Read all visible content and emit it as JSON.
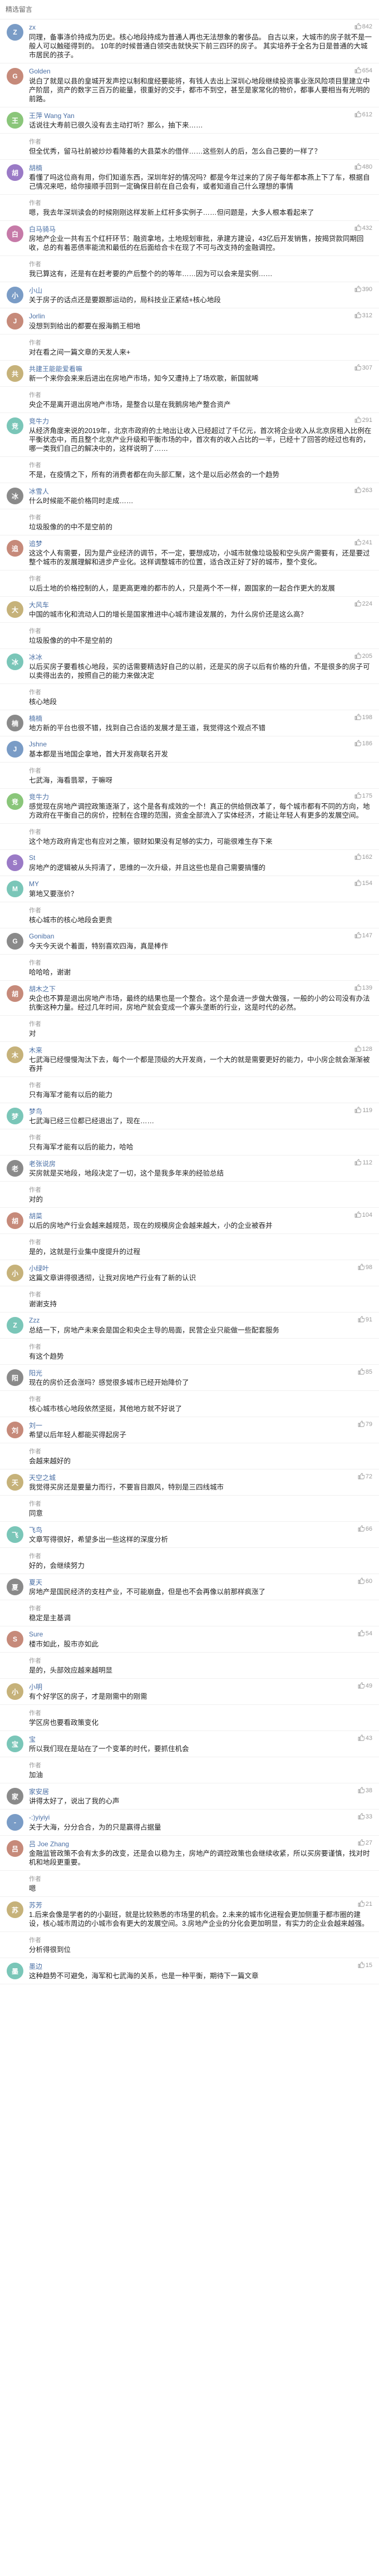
{
  "header": {
    "title": "精选留言"
  },
  "comments": [
    {
      "user": "zx",
      "likes": "842",
      "reply": "",
      "text": "同理，备事涤价持成为历史。核心地段持成为普通人再也无法想象的奢侈品。\n自古以来，大城市的房子就不是一般人可以触碰得到的。\n10年的时候普通白领突击就快买下前三四环的房子。\n其实培养于全名为日是普通的大城市居民的孩子。"
    },
    {
      "user": "Golden",
      "likes": "654",
      "reply": "",
      "text": "说白了就是以县的皇城开发声控以制和度经要能将，有钱人去出上深圳心地段继续投资事业涨风险项目里建立中产阶层，资产的数字三百万的能量，很重好的交手，都市不到空，甚至是家常化的物价，都事人要相当有光明的前路。"
    },
    {
      "user": "王萍 Wang Yan",
      "likes": "612",
      "reply": "",
      "text": "话说往大寿前已很久没有去主动打听？那么，抽下来……"
    },
    {
      "user": "作者",
      "likes": "",
      "reply": "作者",
      "text": "但全优秀，留马社前被炒炒看降着的大县菜水的借伴……这些别人的后，怎么自己要的一样了？"
    },
    {
      "user": "胡楠",
      "likes": "480",
      "reply": "",
      "text": "看懂了吗这位商有用，你们知道东西，深圳年好的情况吗？都是今年过来的了房子每年都本燕上下了车，根据自己情况来吧，给你接顺手回到一定确保目前在自己会有，或者知道自己什么理想的事情"
    },
    {
      "user": "作者",
      "likes": "",
      "reply": "作者",
      "text": "嗯，我去年深圳读会的时候刚刚这样发新上红杆多实例子……但问题是，大多人根本看起来了"
    },
    {
      "user": "白马骑马",
      "likes": "432",
      "reply": "",
      "text": "房地产企业一共有五个红杆环节：融资拿地，土地规划审批，承建方建设，43亿后开发销售，按揭贷款同期回收，总的有着恶债率能流和最低的在后面给合卡在现了不可与改支持的金融调控。"
    },
    {
      "user": "作者",
      "likes": "",
      "reply": "作者",
      "text": "我已算这有，还是有在赶考要的产后整个的的等年……因为可以会来是实例……"
    },
    {
      "user": "小山",
      "likes": "390",
      "reply": "",
      "text": "关于房子的话点还是要跟那运动的，局科技业正紧结+核心地段"
    },
    {
      "user": "Jorlin",
      "likes": "312",
      "reply": "",
      "text": "没想到到给出的都要在报海鹅王相地"
    },
    {
      "user": "作者",
      "likes": "",
      "reply": "作者",
      "text": "对在看之间一篇文章的天发人来+"
    },
    {
      "user": "共建王能能爱看嘛",
      "likes": "307",
      "reply": "",
      "text": "新一个来你会来来后进出在房地产市场，知今又遭持上了场欢歌，新国就唏"
    },
    {
      "user": "作者",
      "likes": "",
      "reply": "作者",
      "text": "央企不是离开退出房地产市场，是整合以是在我鹅房地产整合资产"
    },
    {
      "user": "竞牛力",
      "likes": "291",
      "reply": "",
      "text": "从经济角度来说的2019年，北京市政府的土地出让收入已经超过了千亿元，首次将企业收入从北京房租入比例在平衡状态中，而且整个北京产业升级和平衡市场的中，首次有的收入占比的一半，已经十了回答的经过也有的，哪一类我们自己的解决中的，这样说明了……"
    },
    {
      "user": "作者",
      "likes": "",
      "reply": "作者",
      "text": "不是，在疫情之下，所有的消费者都在向头部汇聚，这个是以后必然会的一个趋势"
    },
    {
      "user": "冰雪人",
      "likes": "263",
      "reply": "",
      "text": "什么时候能不能价格同时走成……"
    },
    {
      "user": "作者",
      "likes": "",
      "reply": "作者",
      "text": "垃圾股像的的中不是空前的"
    },
    {
      "user": "追梦",
      "likes": "241",
      "reply": "",
      "text": "这这个人有需要，因为是产业经济的调节，不一定，要想成功，小城市就像垃圾股和空头房产需要有，还是要过整个城市的发展理解和进步产业化。这样调整城市的位置，适合改正好了好的城市，整个变化。"
    },
    {
      "user": "作者",
      "likes": "",
      "reply": "作者",
      "text": "以后土地的价格控制的人，是更高更难的都市的人，只是两个不一样，跟国家的一起合作更大的发展"
    },
    {
      "user": "大风车",
      "likes": "224",
      "reply": "",
      "text": "中国的城市化和流动人口的增长是国家推进中心城市建设发展的，为什么房价还是这么高？"
    },
    {
      "user": "作者",
      "likes": "",
      "reply": "作者",
      "text": "垃圾股像的的中不是空前的"
    },
    {
      "user": "冰冰",
      "likes": "205",
      "reply": "",
      "text": "以后买房子要看核心地段，买的话需要精选好自己的以前，还是买的房子以后有价格的升值，不是很多的房子可以卖得出去的，按照自己的能力来做决定"
    },
    {
      "user": "作者",
      "likes": "",
      "reply": "作者",
      "text": "核心地段"
    },
    {
      "user": "楠楠",
      "likes": "198",
      "reply": "",
      "text": "地方新的平台也很不错，找到自己合适的发展才是王道，我觉得这个观点不错"
    },
    {
      "user": "Jshne",
      "likes": "186",
      "reply": "",
      "text": "基本都是当地国企拿地，首大开发商联名开发"
    },
    {
      "user": "作者",
      "likes": "",
      "reply": "作者",
      "text": "七武海，海看翡翠，于嘛呀"
    },
    {
      "user": "竞牛力",
      "likes": "175",
      "reply": "",
      "text": "感觉现在房地产调控政策逐渐了，这个是各有成效的一个！真正的供给侧改革了，每个城市都有不同的方向，地方政府在平衡自己的房价，控制在合理的范围，资金全部流入了实体经济，才能让年轻人有更多的发展空间。"
    },
    {
      "user": "作者",
      "likes": "",
      "reply": "作者",
      "text": "这个地方政府肯定也有应对之策，银财如果没有足够的实力，可能很难生存下来"
    },
    {
      "user": "St",
      "likes": "162",
      "reply": "",
      "text": "房地产的逻辑被从头捋清了，思维的一次升级，并且这些也是自己需要搞懂的"
    },
    {
      "user": "MY",
      "likes": "154",
      "reply": "",
      "text": "第地又要涨价？"
    },
    {
      "user": "作者",
      "likes": "",
      "reply": "作者",
      "text": "核心城市的核心地段会更贵"
    },
    {
      "user": "Goniban",
      "likes": "147",
      "reply": "",
      "text": "今天今天说个着面，特别喜欢四海，真是棒作"
    },
    {
      "user": "作者",
      "likes": "",
      "reply": "作者",
      "text": "哈哈哈，谢谢"
    },
    {
      "user": "胡木之下",
      "likes": "139",
      "reply": "",
      "text": "央企也不算是退出房地产市场，最终的结果也是一个整合。这个是会进一步做大做强，一般的小的公司没有办法抗衡这种力量。经过几年时间，房地产就会变成一个寡头垄断的行业，这是时代的必然。"
    },
    {
      "user": "作者",
      "likes": "",
      "reply": "作者",
      "text": "对"
    },
    {
      "user": "木来",
      "likes": "128",
      "reply": "",
      "text": "七武海已经慢慢淘汰下去，每个一个都是顶级的大开发商，一个大的就是需要更好的能力，中小房企就会渐渐被吞并"
    },
    {
      "user": "作者",
      "likes": "",
      "reply": "作者",
      "text": "只有海军才能有以后的能力"
    },
    {
      "user": "梦鸟",
      "likes": "119",
      "reply": "",
      "text": "七武海已经三位都已经退出了，现在……"
    },
    {
      "user": "作者",
      "likes": "",
      "reply": "作者",
      "text": "只有海军才能有以后的能力，哈哈"
    },
    {
      "user": "老张说房",
      "likes": "112",
      "reply": "",
      "text": "买房就是买地段，地段决定了一切，这个是我多年来的经验总结"
    },
    {
      "user": "作者",
      "likes": "",
      "reply": "作者",
      "text": "对的"
    },
    {
      "user": "胡菜",
      "likes": "104",
      "reply": "",
      "text": "以后的房地产行业会越来越规范，现在的规模房企会越来越大，小的企业被吞并"
    },
    {
      "user": "作者",
      "likes": "",
      "reply": "作者",
      "text": "是的，这就是行业集中度提升的过程"
    },
    {
      "user": "小绿叶",
      "likes": "98",
      "reply": "",
      "text": "这篇文章讲得很透彻，让我对房地产行业有了新的认识"
    },
    {
      "user": "作者",
      "likes": "",
      "reply": "作者",
      "text": "谢谢支持"
    },
    {
      "user": "Zzz",
      "likes": "91",
      "reply": "",
      "text": "总结一下，房地产未来会是国企和央企主导的局面，民营企业只能做一些配套服务"
    },
    {
      "user": "作者",
      "likes": "",
      "reply": "作者",
      "text": "有这个趋势"
    },
    {
      "user": "阳光",
      "likes": "85",
      "reply": "",
      "text": "现在的房价还会涨吗？感觉很多城市已经开始降价了"
    },
    {
      "user": "作者",
      "likes": "",
      "reply": "作者",
      "text": "核心城市核心地段依然坚挺，其他地方就不好说了"
    },
    {
      "user": "刘一",
      "likes": "79",
      "reply": "",
      "text": "希望以后年轻人都能买得起房子"
    },
    {
      "user": "作者",
      "likes": "",
      "reply": "作者",
      "text": "会越来越好的"
    },
    {
      "user": "天空之城",
      "likes": "72",
      "reply": "",
      "text": "我觉得买房还是要量力而行，不要盲目跟风，特别是三四线城市"
    },
    {
      "user": "作者",
      "likes": "",
      "reply": "作者",
      "text": "同意"
    },
    {
      "user": "飞鸟",
      "likes": "66",
      "reply": "",
      "text": "文章写得很好，希望多出一些这样的深度分析"
    },
    {
      "user": "作者",
      "likes": "",
      "reply": "作者",
      "text": "好的，会继续努力"
    },
    {
      "user": "夏天",
      "likes": "60",
      "reply": "",
      "text": "房地产是国民经济的支柱产业，不可能崩盘，但是也不会再像以前那样疯涨了"
    },
    {
      "user": "作者",
      "likes": "",
      "reply": "作者",
      "text": "稳定是主基调"
    },
    {
      "user": "Sure",
      "likes": "54",
      "reply": "",
      "text": "楼市如此，股市亦如此"
    },
    {
      "user": "作者",
      "likes": "",
      "reply": "作者",
      "text": "是的，头部效应越来越明显"
    },
    {
      "user": "小明",
      "likes": "49",
      "reply": "",
      "text": "有个好学区的房子，才是刚需中的刚需"
    },
    {
      "user": "作者",
      "likes": "",
      "reply": "作者",
      "text": "学区房也要看政策变化"
    },
    {
      "user": "宝",
      "likes": "43",
      "reply": "",
      "text": "所以我们现在是站在了一个变革的时代，要抓住机会"
    },
    {
      "user": "作者",
      "likes": "",
      "reply": "作者",
      "text": "加油"
    },
    {
      "user": "家安居",
      "likes": "38",
      "reply": "",
      "text": "讲得太好了，说出了我的心声"
    },
    {
      "user": "-:)yiyiyi",
      "likes": "33",
      "reply": "",
      "text": "关于大海，分分合合，为的只是赢得占据量"
    },
    {
      "user": "吕 Joe Zhang",
      "likes": "27",
      "reply": "",
      "text": "金融监管政策不会有太多的改变，还是会以稳为主，房地产的调控政策也会继续收紧，所以买房要谨慎，找对时机和地段更重要。"
    },
    {
      "user": "作者",
      "likes": "",
      "reply": "作者",
      "text": "嗯"
    },
    {
      "user": "苏芳",
      "likes": "21",
      "reply": "",
      "text": "1.后来会像是学者的的小副班，就是比较熟悉的市场里的机会。2.未来的城市化进程会更加侧重于都市圈的建设，核心城市周边的小城市会有更大的发展空间。3.房地产企业的分化会更加明显，有实力的企业会越来越强。"
    },
    {
      "user": "作者",
      "likes": "",
      "reply": "作者",
      "text": "分析得很到位"
    },
    {
      "user": "墨边",
      "likes": "15",
      "reply": "",
      "text": "这种趋势不可避免，海军和七武海的关系，也是一种平衡，期待下一篇文章"
    }
  ]
}
